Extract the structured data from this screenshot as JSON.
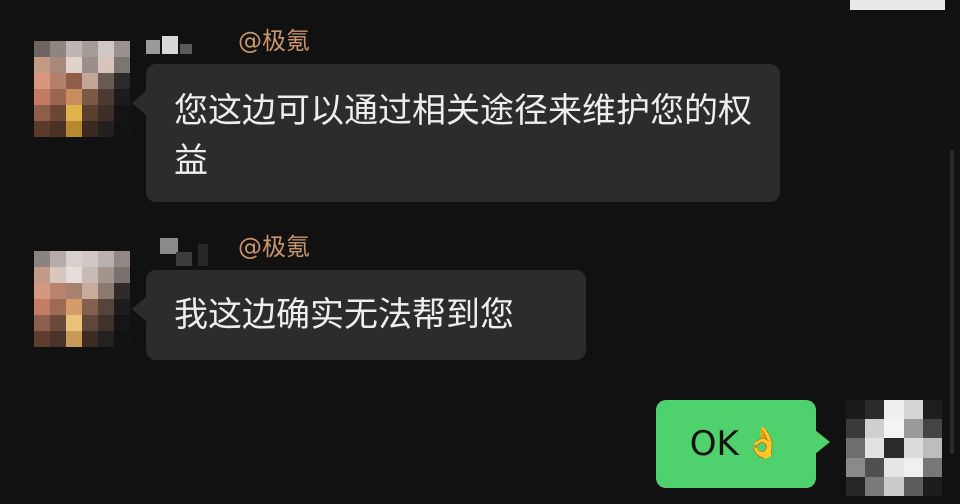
{
  "messages": [
    {
      "sender": "@极氪",
      "text": "您这边可以通过相关途径来维护您的权益"
    },
    {
      "sender": "@极氪",
      "text": "我这边确实无法帮到您"
    },
    {
      "sender": "self",
      "text": "OK",
      "emoji": "👌"
    }
  ],
  "colors": {
    "background": "#111111",
    "incoming_bubble": "#2c2c2c",
    "outgoing_bubble": "#4fd16d",
    "nickname": "#c8956a"
  },
  "icons": [
    "blurred-avatar",
    "ok-hand-emoji"
  ]
}
